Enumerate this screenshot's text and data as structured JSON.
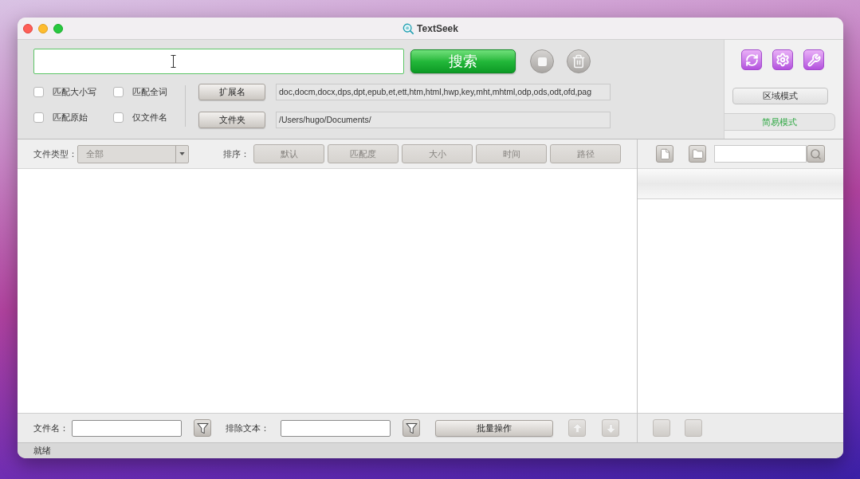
{
  "window": {
    "title": "TextSeek"
  },
  "search": {
    "button": "搜索"
  },
  "options": [
    {
      "label": "匹配大小写",
      "checked": false
    },
    {
      "label": "匹配全词",
      "checked": false
    },
    {
      "label": "匹配原始",
      "checked": false
    },
    {
      "label": "仅文件名",
      "checked": false
    }
  ],
  "paths": [
    {
      "button": "扩展名",
      "value": "doc,docm,docx,dps,dpt,epub,et,ett,htm,html,hwp,key,mht,mhtml,odp,ods,odt,ofd,pag"
    },
    {
      "button": "文件夹",
      "value": "/Users/hugo/Documents/"
    }
  ],
  "modes": [
    {
      "label": "区域模式",
      "selected": false
    },
    {
      "label": "简易模式",
      "selected": true
    }
  ],
  "filter_bar": {
    "file_type": {
      "label": "文件类型：",
      "value": "全部",
      "disabled": true
    },
    "sort": {
      "label": "排序：",
      "buttons": [
        {
          "label": "默认",
          "disabled": true
        },
        {
          "label": "匹配度",
          "disabled": true
        },
        {
          "label": "大小",
          "disabled": true
        },
        {
          "label": "时间",
          "disabled": true
        },
        {
          "label": "路径",
          "disabled": true
        }
      ]
    }
  },
  "bottom_bar": {
    "file_name": {
      "label": "文件名："
    },
    "exclude_text": {
      "label": "排除文本："
    },
    "batch_button": "批量操作"
  },
  "status_bar": {
    "text": "就绪"
  }
}
